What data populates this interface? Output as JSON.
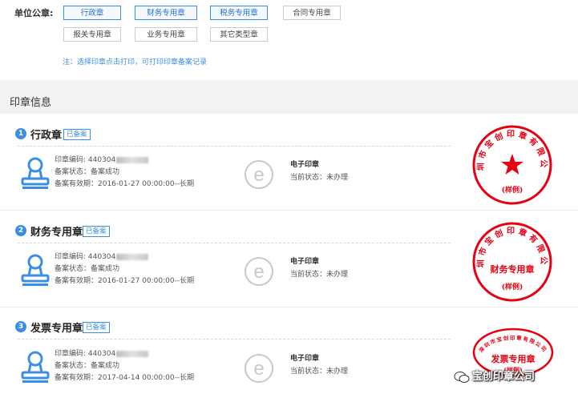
{
  "seal_types": {
    "label": "单位公章:",
    "buttons": [
      {
        "label": "行政章",
        "active": true
      },
      {
        "label": "财务专用章",
        "active": true
      },
      {
        "label": "税务专用章",
        "active": true
      },
      {
        "label": "合同专用章",
        "active": false
      },
      {
        "label": "报关专用章",
        "active": false
      },
      {
        "label": "业务专用章",
        "active": false
      },
      {
        "label": "其它类型章",
        "active": false
      }
    ],
    "note": "注：选择印章点击打印，可打印印章备案记录"
  },
  "section": {
    "title": "印章信息"
  },
  "seals": [
    {
      "number": "1",
      "name": "行政章",
      "badge": "已备案",
      "code_label": "印章编码: ",
      "code_prefix": "440304",
      "record_status": "备案状态：备案成功",
      "validity": "备案有效期：2016-01-27 00:00:00--长期",
      "electronic_title": "电子印章",
      "electronic_status": "当前状态：未办理",
      "stamp_label": "(样例)"
    },
    {
      "number": "2",
      "name": "财务专用章",
      "badge": "已备案",
      "code_label": "印章编码: ",
      "code_prefix": "440304",
      "record_status": "备案状态：备案成功",
      "validity": "备案有效期：2016-01-27 00:00:00--长期",
      "electronic_title": "电子印章",
      "electronic_status": "当前状态：未办理",
      "stamp_center": "财务专用章",
      "stamp_label": "(样例)"
    },
    {
      "number": "3",
      "name": "发票专用章",
      "badge": "已备案",
      "code_label": "印章编码: ",
      "code_prefix": "440304",
      "record_status": "备案状态：备案成功",
      "validity": "备案有效期：2017-04-14 00:00:00--长期",
      "electronic_title": "电子印章",
      "electronic_status": "当前状态：未办理",
      "stamp_center": "发票专用章",
      "stamp_label": "(样例)"
    }
  ],
  "watermark": {
    "text": "宝创印章公司"
  },
  "colors": {
    "accent": "#3a8ee6",
    "stamp_red": "#e60012"
  }
}
